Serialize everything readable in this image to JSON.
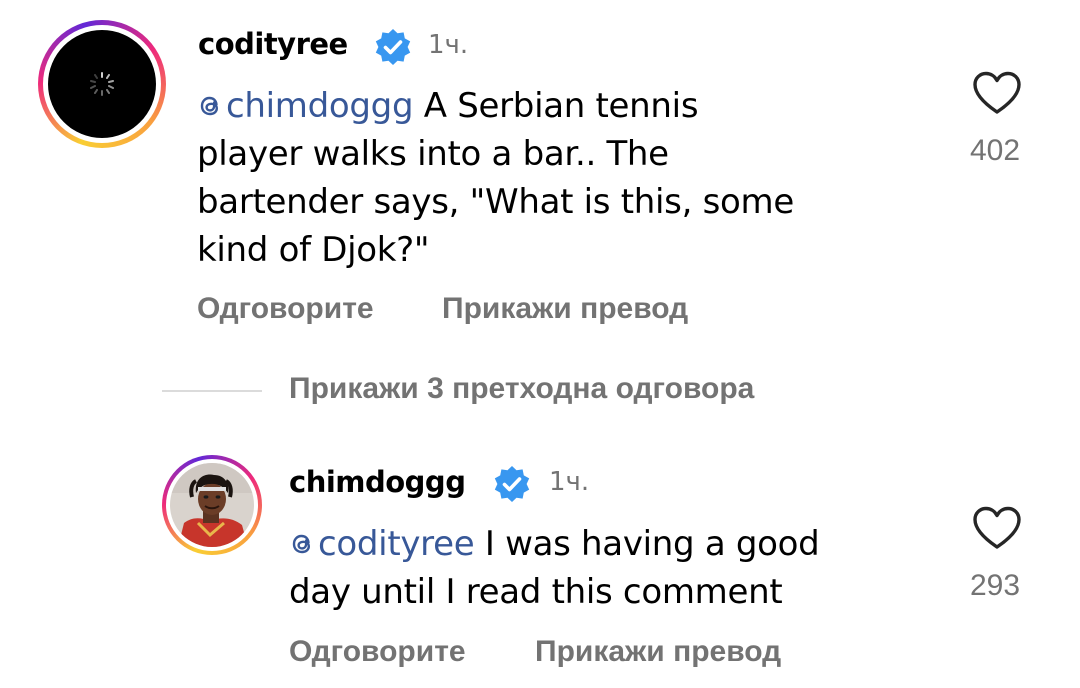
{
  "comments": [
    {
      "username": "codityree",
      "time": "1ч.",
      "mention": "chimdoggg",
      "text_lines": [
        " A Serbian tennis",
        "player walks into a bar.. The",
        "bartender says, \"What is this, some",
        "kind of Djok?\""
      ],
      "likes": "402",
      "reply_label": "Одговорите",
      "translate_label": "Прикажи превод",
      "avatar": "loading-spinner-icon"
    },
    {
      "username": "chimdoggg",
      "time": "1ч.",
      "mention": "codityree",
      "text_lines": [
        " I was having a good",
        "day until I read this comment"
      ],
      "likes": "293",
      "reply_label": "Одговорите",
      "translate_label": "Прикажи превод",
      "avatar": "user-photo"
    }
  ],
  "previous_replies_label": "Прикажи 3 претходна одговора",
  "colors": {
    "verified": "#3897f0",
    "mention": "#385898",
    "secondary_text": "#737373",
    "divider": "#dbdbdb"
  }
}
